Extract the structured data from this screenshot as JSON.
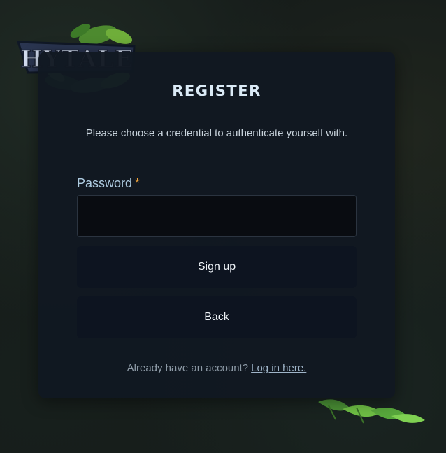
{
  "logo": {
    "text": "HYTALE"
  },
  "form": {
    "title": "REGISTER",
    "subtitle": "Please choose a credential to authenticate yourself with.",
    "password_label": "Password",
    "required_marker": "*",
    "password_value": "",
    "signup_label": "Sign up",
    "back_label": "Back",
    "footer_text": "Already have an account?",
    "footer_link": "Log in here."
  },
  "colors": {
    "background": "#161c1a",
    "card": "#111821",
    "title": "#dbeaf6",
    "label": "#aecbe0",
    "required": "#f0a33a",
    "button_bg": "#0d1420",
    "input_bg": "#090c11"
  },
  "icons": {
    "logo": "hytale-logo",
    "decoration": "leaves-decoration"
  }
}
